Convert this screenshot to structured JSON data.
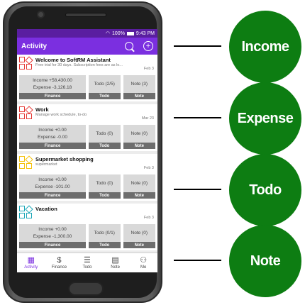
{
  "status": {
    "battery_text": "100%",
    "time": "9:43 PM"
  },
  "appbar": {
    "title": "Activity",
    "add_symbol": "+"
  },
  "cards": [
    {
      "title": "Welcome to SoftRM Assistant",
      "subtitle": "Free trial for 30 days. Subscription fees are as lo...",
      "date": "Feb 3",
      "logo_color": "red",
      "finance": {
        "income": "Income +58,430.00",
        "expense": "Expense -3,126.18",
        "label": "Finance"
      },
      "todo": {
        "count": "Todo (2/5)",
        "label": "Todo"
      },
      "note": {
        "count": "Note (3)",
        "label": "Note"
      }
    },
    {
      "title": "Work",
      "subtitle": "Manage work schedule, to-do",
      "date": "Mar 23",
      "logo_color": "red",
      "finance": {
        "income": "Income +0.00",
        "expense": "Expense -0.00",
        "label": "Finance"
      },
      "todo": {
        "count": "Todo (0)",
        "label": "Todo"
      },
      "note": {
        "count": "Note (0)",
        "label": "Note"
      }
    },
    {
      "title": "Supermarket shopping",
      "subtitle": "supermarket",
      "date": "Feb 3",
      "logo_color": "yellow",
      "finance": {
        "income": "Income +0.00",
        "expense": "Expense -101.00",
        "label": "Finance"
      },
      "todo": {
        "count": "Todo (0)",
        "label": "Todo"
      },
      "note": {
        "count": "Note (0)",
        "label": "Note"
      }
    },
    {
      "title": "Vacation",
      "subtitle": "",
      "date": "Feb 3",
      "logo_color": "teal",
      "finance": {
        "income": "Income +0.00",
        "expense": "Expense -1,300.00",
        "label": "Finance"
      },
      "todo": {
        "count": "Todo (0/1)",
        "label": "Todo"
      },
      "note": {
        "count": "Note (0)",
        "label": "Note"
      }
    }
  ],
  "nav": [
    {
      "label": "Activity",
      "icon": "grid-icon",
      "glyph": "▦",
      "active": true
    },
    {
      "label": "Finance",
      "icon": "dollar-icon",
      "glyph": "$",
      "active": false
    },
    {
      "label": "Todo",
      "icon": "list-icon",
      "glyph": "☰",
      "active": false
    },
    {
      "label": "Note",
      "icon": "note-icon",
      "glyph": "▤",
      "active": false
    },
    {
      "label": "Me",
      "icon": "person-icon",
      "glyph": "⚇",
      "active": false
    }
  ],
  "callouts": [
    "Income",
    "Expense",
    "Todo",
    "Note"
  ],
  "colors": {
    "primary": "#7b2fe0",
    "statusbar": "#5a1ea0",
    "callout": "#0d7d12"
  }
}
